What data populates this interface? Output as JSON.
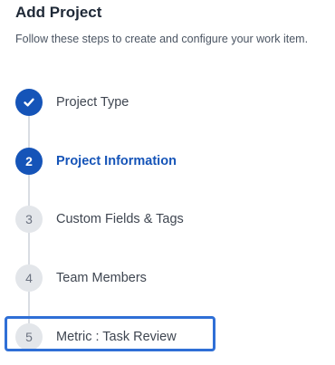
{
  "header": {
    "title": "Add Project",
    "subtitle": "Follow these steps to create and configure your work item."
  },
  "steps": [
    {
      "number": "",
      "label": "Project Type",
      "status": "completed",
      "icon": "check-icon"
    },
    {
      "number": "2",
      "label": "Project Information",
      "status": "active"
    },
    {
      "number": "3",
      "label": "Custom Fields & Tags",
      "status": "pending"
    },
    {
      "number": "4",
      "label": "Team Members",
      "status": "pending"
    },
    {
      "number": "5",
      "label": "Metric : Task Review",
      "status": "pending",
      "highlighted": true
    }
  ],
  "colors": {
    "accent": "#1554b8",
    "highlight_border": "#2f6fd6",
    "pending_circle": "#e3e6ea",
    "connector": "#d9dde3"
  }
}
